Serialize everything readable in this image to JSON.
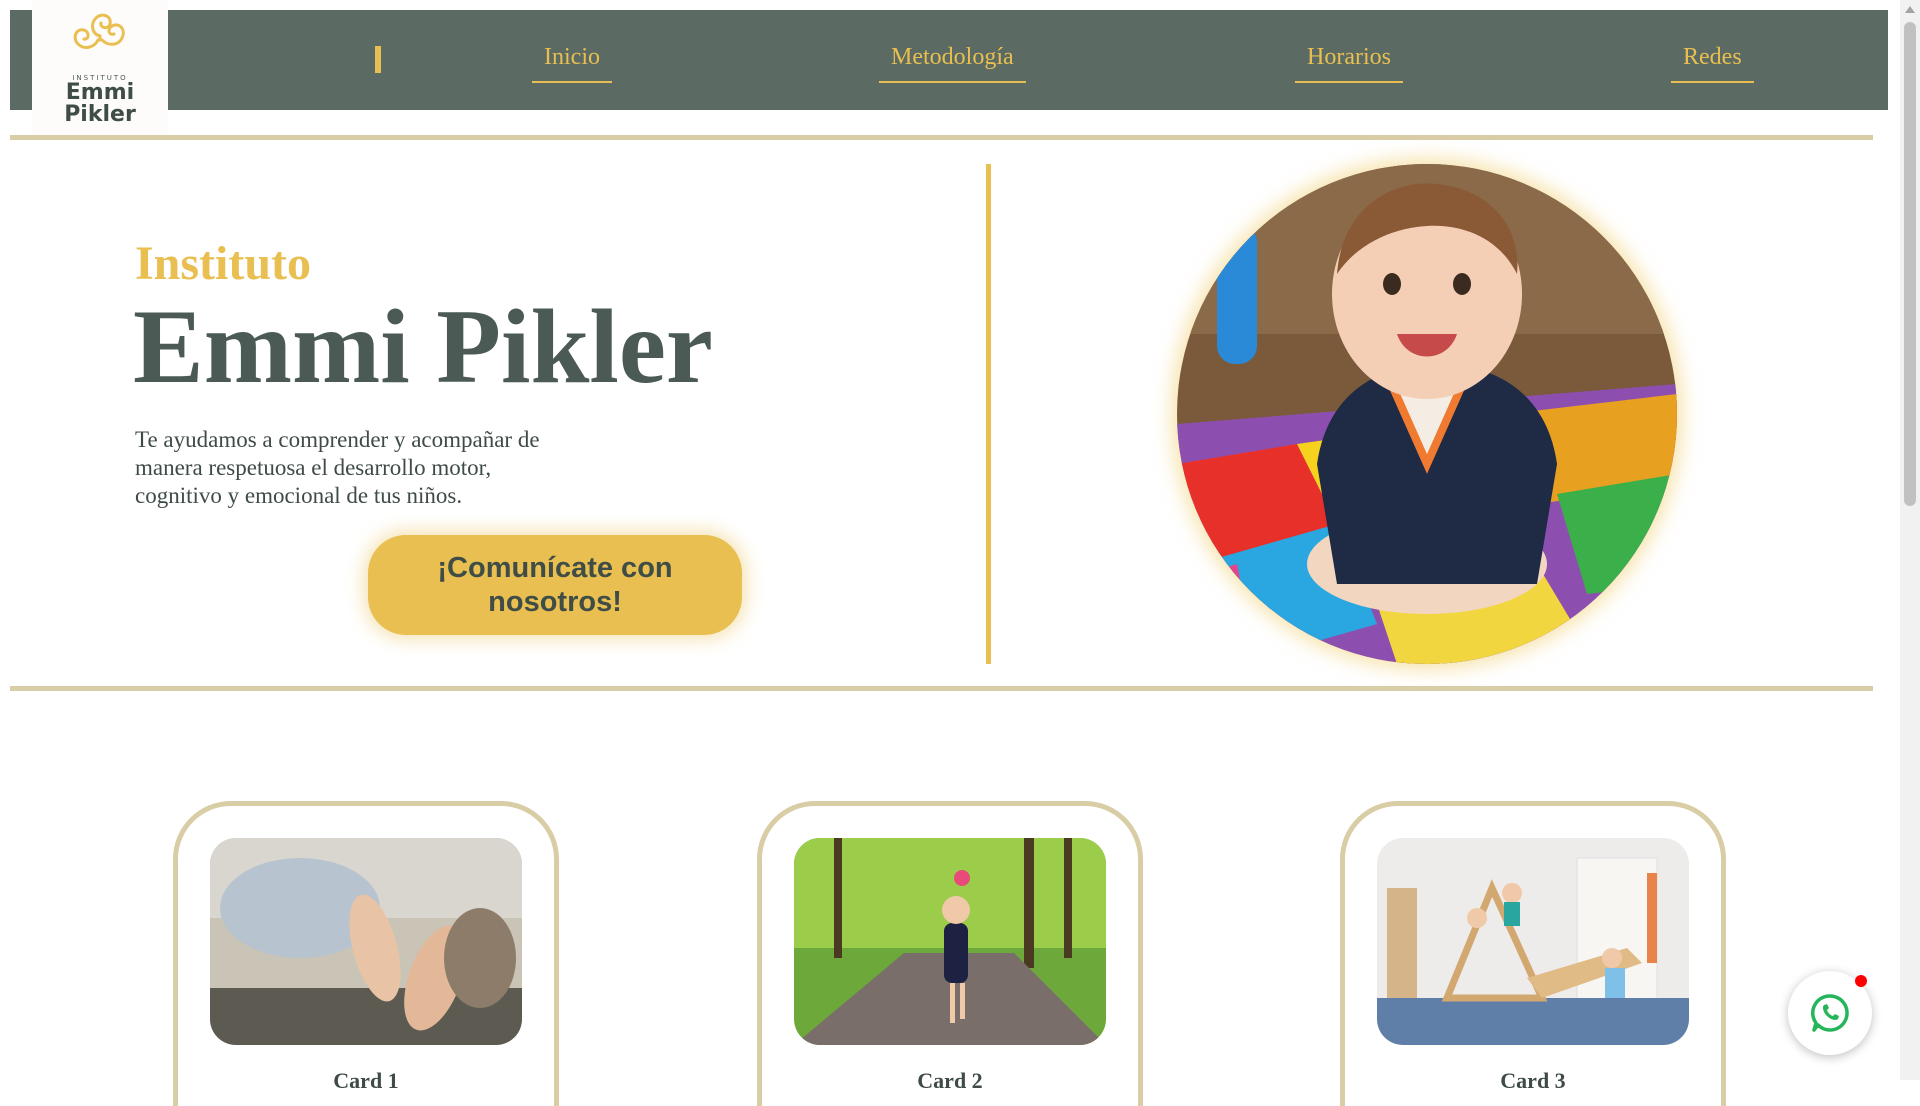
{
  "logo": {
    "small_text": "INSTITUTO",
    "line1": "Emmi",
    "line2": "Pikler",
    "color": "#e8bf50"
  },
  "nav": {
    "items": [
      {
        "label": "Inicio"
      },
      {
        "label": "Metodología"
      },
      {
        "label": "Horarios"
      },
      {
        "label": "Redes"
      }
    ],
    "background": "#5b6b63",
    "accent": "#e8bf50"
  },
  "hero": {
    "pre_title": "Instituto",
    "title": "Emmi Pikler",
    "description": "Te ayudamos a comprender y acompañar de manera respetuosa el desarrollo motor, cognitivo y emocional de tus niños.",
    "cta_label": "¡Comunícate con nosotros!",
    "photo": "crawling-baby-photo"
  },
  "cards": [
    {
      "title": "Card 1",
      "image": "baby-feet-photo"
    },
    {
      "title": "Card 2",
      "image": "girl-running-park-photo"
    },
    {
      "title": "Card 3",
      "image": "pikler-triangle-playroom-photo"
    }
  ],
  "whatsapp": {
    "icon": "whatsapp-icon",
    "notification_color": "#ff0000"
  }
}
